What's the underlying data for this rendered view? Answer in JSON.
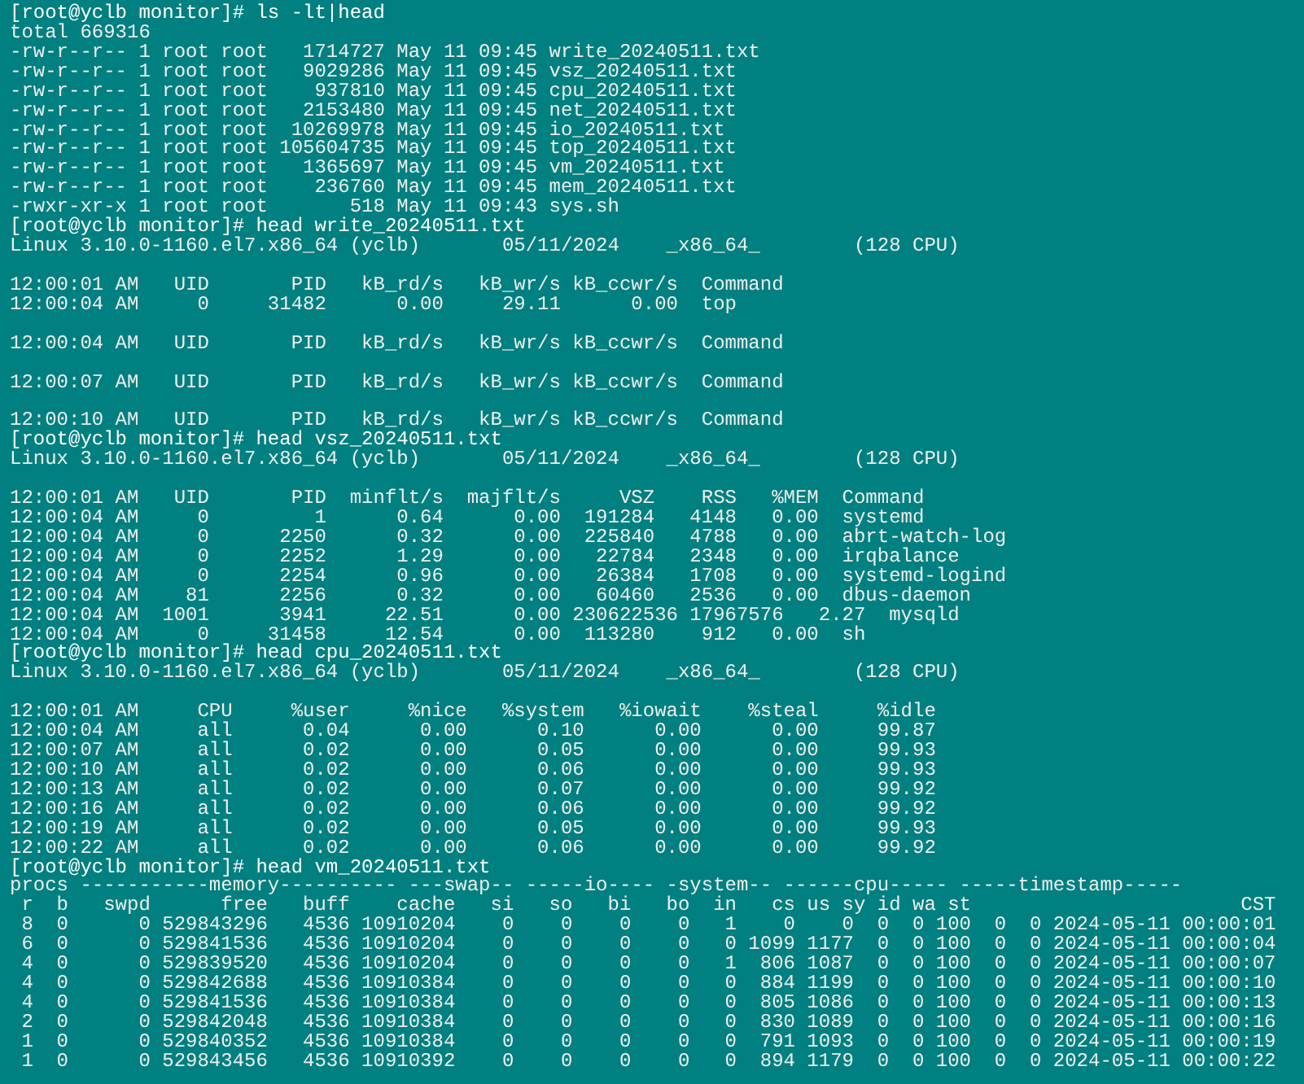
{
  "terminal": {
    "lines": [
      {
        "kind": "command",
        "text": "[root@yclb monitor]# ls -lt|head"
      },
      {
        "kind": "output",
        "text": "total 669316"
      },
      {
        "kind": "output",
        "text": "-rw-r--r-- 1 root root   1714727 May 11 09:45 write_20240511.txt"
      },
      {
        "kind": "output",
        "text": "-rw-r--r-- 1 root root   9029286 May 11 09:45 vsz_20240511.txt"
      },
      {
        "kind": "output",
        "text": "-rw-r--r-- 1 root root    937810 May 11 09:45 cpu_20240511.txt"
      },
      {
        "kind": "output",
        "text": "-rw-r--r-- 1 root root   2153480 May 11 09:45 net_20240511.txt"
      },
      {
        "kind": "output",
        "text": "-rw-r--r-- 1 root root  10269978 May 11 09:45 io_20240511.txt"
      },
      {
        "kind": "output",
        "text": "-rw-r--r-- 1 root root 105604735 May 11 09:45 top_20240511.txt"
      },
      {
        "kind": "output",
        "text": "-rw-r--r-- 1 root root   1365697 May 11 09:45 vm_20240511.txt"
      },
      {
        "kind": "output",
        "text": "-rw-r--r-- 1 root root    236760 May 11 09:45 mem_20240511.txt"
      },
      {
        "kind": "output",
        "text": "-rwxr-xr-x 1 root root       518 May 11 09:43 sys.sh"
      },
      {
        "kind": "command",
        "text": "[root@yclb monitor]# head write_20240511.txt"
      },
      {
        "kind": "output",
        "text": "Linux 3.10.0-1160.el7.x86_64 (yclb)       05/11/2024    _x86_64_        (128 CPU)"
      },
      {
        "kind": "blank"
      },
      {
        "kind": "output",
        "text": "12:00:01 AM   UID       PID   kB_rd/s   kB_wr/s kB_ccwr/s  Command"
      },
      {
        "kind": "output",
        "text": "12:00:04 AM     0     31482      0.00     29.11      0.00  top"
      },
      {
        "kind": "blank"
      },
      {
        "kind": "output",
        "text": "12:00:04 AM   UID       PID   kB_rd/s   kB_wr/s kB_ccwr/s  Command"
      },
      {
        "kind": "blank"
      },
      {
        "kind": "output",
        "text": "12:00:07 AM   UID       PID   kB_rd/s   kB_wr/s kB_ccwr/s  Command"
      },
      {
        "kind": "blank"
      },
      {
        "kind": "output",
        "text": "12:00:10 AM   UID       PID   kB_rd/s   kB_wr/s kB_ccwr/s  Command"
      },
      {
        "kind": "command",
        "text": "[root@yclb monitor]# head vsz_20240511.txt"
      },
      {
        "kind": "output",
        "text": "Linux 3.10.0-1160.el7.x86_64 (yclb)       05/11/2024    _x86_64_        (128 CPU)"
      },
      {
        "kind": "blank"
      },
      {
        "kind": "output",
        "text": "12:00:01 AM   UID       PID  minflt/s  majflt/s     VSZ    RSS   %MEM  Command"
      },
      {
        "kind": "output",
        "text": "12:00:04 AM     0         1      0.64      0.00  191284   4148   0.00  systemd"
      },
      {
        "kind": "output",
        "text": "12:00:04 AM     0      2250      0.32      0.00  225840   4788   0.00  abrt-watch-log"
      },
      {
        "kind": "output",
        "text": "12:00:04 AM     0      2252      1.29      0.00   22784   2348   0.00  irqbalance"
      },
      {
        "kind": "output",
        "text": "12:00:04 AM     0      2254      0.96      0.00   26384   1708   0.00  systemd-logind"
      },
      {
        "kind": "output",
        "text": "12:00:04 AM    81      2256      0.32      0.00   60460   2536   0.00  dbus-daemon"
      },
      {
        "kind": "output",
        "text": "12:00:04 AM  1001      3941     22.51      0.00 230622536 17967576   2.27  mysqld"
      },
      {
        "kind": "output",
        "text": "12:00:04 AM     0     31458     12.54      0.00  113280    912   0.00  sh"
      },
      {
        "kind": "command",
        "text": "[root@yclb monitor]# head cpu_20240511.txt"
      },
      {
        "kind": "output",
        "text": "Linux 3.10.0-1160.el7.x86_64 (yclb)       05/11/2024    _x86_64_        (128 CPU)"
      },
      {
        "kind": "blank"
      },
      {
        "kind": "output",
        "text": "12:00:01 AM     CPU     %user     %nice   %system   %iowait    %steal     %idle"
      },
      {
        "kind": "output",
        "text": "12:00:04 AM     all      0.04      0.00      0.10      0.00      0.00     99.87"
      },
      {
        "kind": "output",
        "text": "12:00:07 AM     all      0.02      0.00      0.05      0.00      0.00     99.93"
      },
      {
        "kind": "output",
        "text": "12:00:10 AM     all      0.02      0.00      0.06      0.00      0.00     99.93"
      },
      {
        "kind": "output",
        "text": "12:00:13 AM     all      0.02      0.00      0.07      0.00      0.00     99.92"
      },
      {
        "kind": "output",
        "text": "12:00:16 AM     all      0.02      0.00      0.06      0.00      0.00     99.92"
      },
      {
        "kind": "output",
        "text": "12:00:19 AM     all      0.02      0.00      0.05      0.00      0.00     99.93"
      },
      {
        "kind": "output",
        "text": "12:00:22 AM     all      0.02      0.00      0.06      0.00      0.00     99.92"
      },
      {
        "kind": "command",
        "text": "[root@yclb monitor]# head vm_20240511.txt"
      },
      {
        "kind": "output",
        "text": "procs -----------memory---------- ---swap-- -----io---- -system-- ------cpu----- -----timestamp-----"
      },
      {
        "kind": "output",
        "text": " r  b   swpd      free   buff    cache   si   so   bi   bo  in   cs us sy id wa st                       CST"
      },
      {
        "kind": "output",
        "text": " 8  0      0 529843296   4536 10910204    0    0    0    0   1    0    0  0  0 100  0  0 2024-05-11 00:00:01"
      },
      {
        "kind": "output",
        "text": " 6  0      0 529841536   4536 10910204    0    0    0    0   0 1099 1177  0  0 100  0  0 2024-05-11 00:00:04"
      },
      {
        "kind": "output",
        "text": " 4  0      0 529839520   4536 10910204    0    0    0    0   1  806 1087  0  0 100  0  0 2024-05-11 00:00:07"
      },
      {
        "kind": "output",
        "text": " 4  0      0 529842688   4536 10910384    0    0    0    0   0  884 1199  0  0 100  0  0 2024-05-11 00:00:10"
      },
      {
        "kind": "output",
        "text": " 4  0      0 529841536   4536 10910384    0    0    0    0   0  805 1086  0  0 100  0  0 2024-05-11 00:00:13"
      },
      {
        "kind": "output",
        "text": " 2  0      0 529842048   4536 10910384    0    0    0    0   0  830 1089  0  0 100  0  0 2024-05-11 00:00:16"
      },
      {
        "kind": "output",
        "text": " 1  0      0 529840352   4536 10910384    0    0    0    0   0  791 1093  0  0 100  0  0 2024-05-11 00:00:19"
      },
      {
        "kind": "output",
        "text": " 1  0      0 529843456   4536 10910392    0    0    0    0   0  894 1179  0  0 100  0  0 2024-05-11 00:00:22"
      }
    ]
  }
}
